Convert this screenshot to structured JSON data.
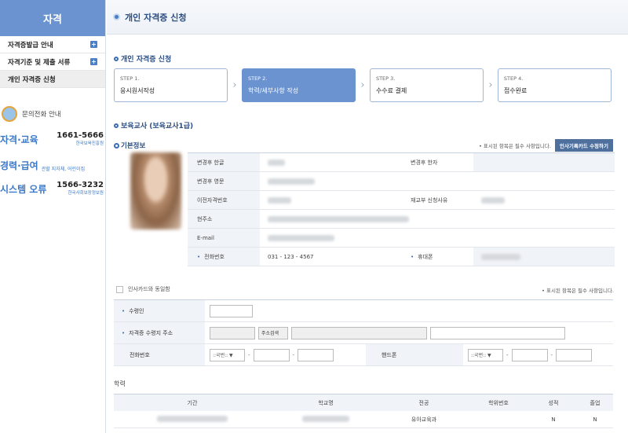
{
  "sidebar": {
    "title": "자격",
    "items": [
      {
        "label": "자격증발급 안내",
        "plus": "+"
      },
      {
        "label": "자격기준 및 제출 서류",
        "plus": "+"
      },
      {
        "label": "개인 자격증 신청"
      }
    ],
    "phone_guide": "문의전화 안내",
    "contacts": [
      {
        "name": "자격·교육",
        "number": "1661-5666",
        "org": "한국보육진흥원"
      },
      {
        "name": "경력·급여",
        "org": "관할 지자체, 어린이집"
      },
      {
        "name": "시스템 오류",
        "number": "1566-3232",
        "org": "한국사회보장정보원"
      }
    ]
  },
  "header": {
    "title": "개인 자격증 신청"
  },
  "section_title": "개인 자격증 신청",
  "steps": [
    {
      "num": "STEP 1.",
      "name": "응시원서작성",
      "active": false
    },
    {
      "num": "STEP 2.",
      "name": "학력/세부사항 작성",
      "active": true
    },
    {
      "num": "STEP 3.",
      "name": "수수료 결제",
      "active": false
    },
    {
      "num": "STEP 4.",
      "name": "접수완료",
      "active": false
    }
  ],
  "qualification_title": "보육교사 (보육교사1급)",
  "basic_info": {
    "title": "기본정보",
    "required_note": "• 표시된 항목은 필수 사항입니다.",
    "edit_button": "인사기록카드 수정하기",
    "rows": {
      "korean_name": "변경후 한글",
      "hanja_name": "변경후 한자",
      "english_name": "변경후 영문",
      "prev_cert_no": "이전자격번호",
      "reissue_reason": "재교부 신청사유",
      "address": "현주소",
      "email": "E-mail",
      "phone": "전화번호",
      "phone_value": "031 - 123 - 4567",
      "mobile": "휴대폰"
    }
  },
  "same_as_card": "인사카드와 동일함",
  "required_note_2": "• 표시된 항목은 필수 사항입니다.",
  "form": {
    "recipient": "수령인",
    "address": "자격증 수령지 주소",
    "address_search": "주소검색",
    "phone": "전화번호",
    "mobile": "핸드폰",
    "select_placeholder": "::국번:: ▼",
    "dash": "-"
  },
  "education": {
    "title": "학력",
    "headers": [
      "기간",
      "학교명",
      "전공",
      "학위번호",
      "성적",
      "졸업"
    ],
    "rows": [
      {
        "major": "유아교육과",
        "grade": "N",
        "graduated": "N"
      }
    ]
  },
  "colors": {
    "accent": "#6b93cf",
    "title_blue": "#2b4e83",
    "link_blue": "#3a78c9"
  }
}
